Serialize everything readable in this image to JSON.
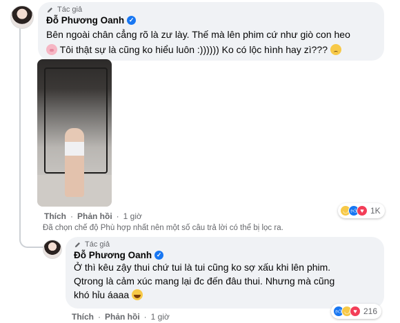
{
  "comment1": {
    "author_role": "Tác giả",
    "author_name": "Đỗ Phương Oanh",
    "line1": "Bên ngoài chân cẳng rõ là zư lày. Thế mà lên phim cứ như giò con heo",
    "line2": "Tôi thật sự là cũng ko hiểu luôn :)))))) Ko có lộc hình hay zì???",
    "action_like": "Thích",
    "action_reply": "Phản hồi",
    "time": "1 giờ",
    "reaction_count": "1K"
  },
  "filter_notice": "Đã chọn chế độ Phù hợp nhất nên một số câu trả lời có thể bị lọc ra.",
  "comment2": {
    "author_role": "Tác giả",
    "author_name": "Đỗ Phương Oanh",
    "line1": "Ở thì kêu zậy thui chứ tui là tui cũng ko sợ xấu khi lên phim.",
    "line2": "Qtrong là cảm xúc mang lại đc đến đâu thui. Nhưng mà cũng",
    "line3": "khó hỉu áaaa",
    "action_like": "Thích",
    "action_reply": "Phản hồi",
    "time": "1 giờ",
    "reaction_count": "216"
  },
  "icons": {
    "verified": "verified-badge-icon",
    "author_badge": "pencil-author-icon",
    "reactions": [
      "haha-icon",
      "like-icon",
      "love-icon"
    ]
  },
  "colors": {
    "bubble": "#f0f2f5",
    "muted_text": "#65676b",
    "like_blue": "#1877f2",
    "love_red": "#f33e58"
  }
}
